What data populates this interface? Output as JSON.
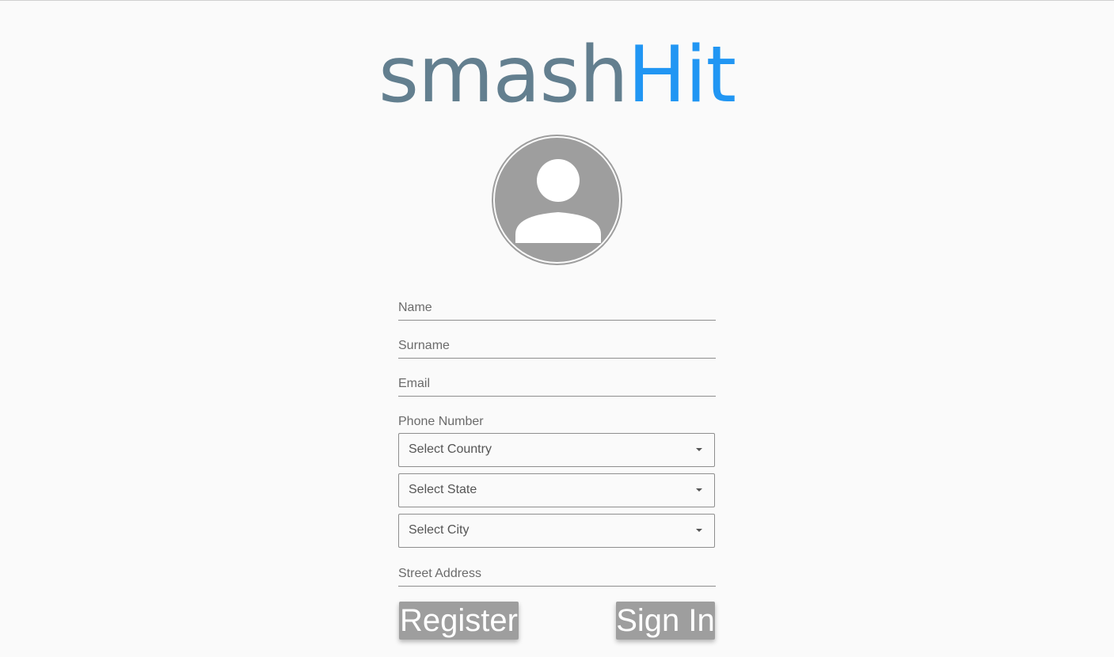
{
  "logo": {
    "part1": "smash",
    "part2": "Hit",
    "color_part1": "#637f8f",
    "color_part2": "#2196f3"
  },
  "avatar": {
    "icon": "user-placeholder-icon"
  },
  "form": {
    "name": {
      "placeholder": "Name",
      "value": ""
    },
    "surname": {
      "placeholder": "Surname",
      "value": ""
    },
    "email": {
      "placeholder": "Email",
      "value": ""
    },
    "phone": {
      "placeholder": "Phone Number",
      "value": ""
    },
    "country": {
      "label": "Select Country"
    },
    "state": {
      "label": "Select State"
    },
    "city": {
      "label": "Select City"
    },
    "street": {
      "placeholder": "Street Address",
      "value": ""
    }
  },
  "buttons": {
    "register": "Register",
    "signin": "Sign In"
  }
}
